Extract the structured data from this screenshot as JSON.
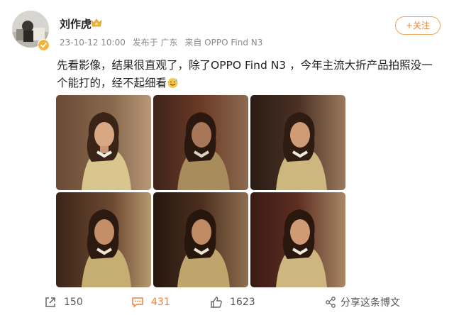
{
  "user": {
    "name": "刘作虎"
  },
  "meta": {
    "timestamp": "23-10-12 10:00",
    "location": "发布于 广东",
    "source": "来自 OPPO Find N3"
  },
  "follow": {
    "label": "+关注"
  },
  "post": {
    "text": "先看影像，结果很直观了，除了OPPO Find N3 ，今年主流大折产品拍照没一个能打的，经不起细看"
  },
  "actions": {
    "repost_count": "150",
    "comment_count": "431",
    "like_count": "1623",
    "share_label": "分享这条博文"
  },
  "icons": {
    "crown": "crown-icon",
    "verified": "verified-badge-icon",
    "emoji": "sweat-smile-emoji-icon",
    "repost": "repost-icon",
    "comment": "comment-icon",
    "like": "thumbs-up-icon",
    "share": "share-icon"
  },
  "colors": {
    "accent": "#e8843a",
    "meta_text": "#8a8a8a"
  }
}
